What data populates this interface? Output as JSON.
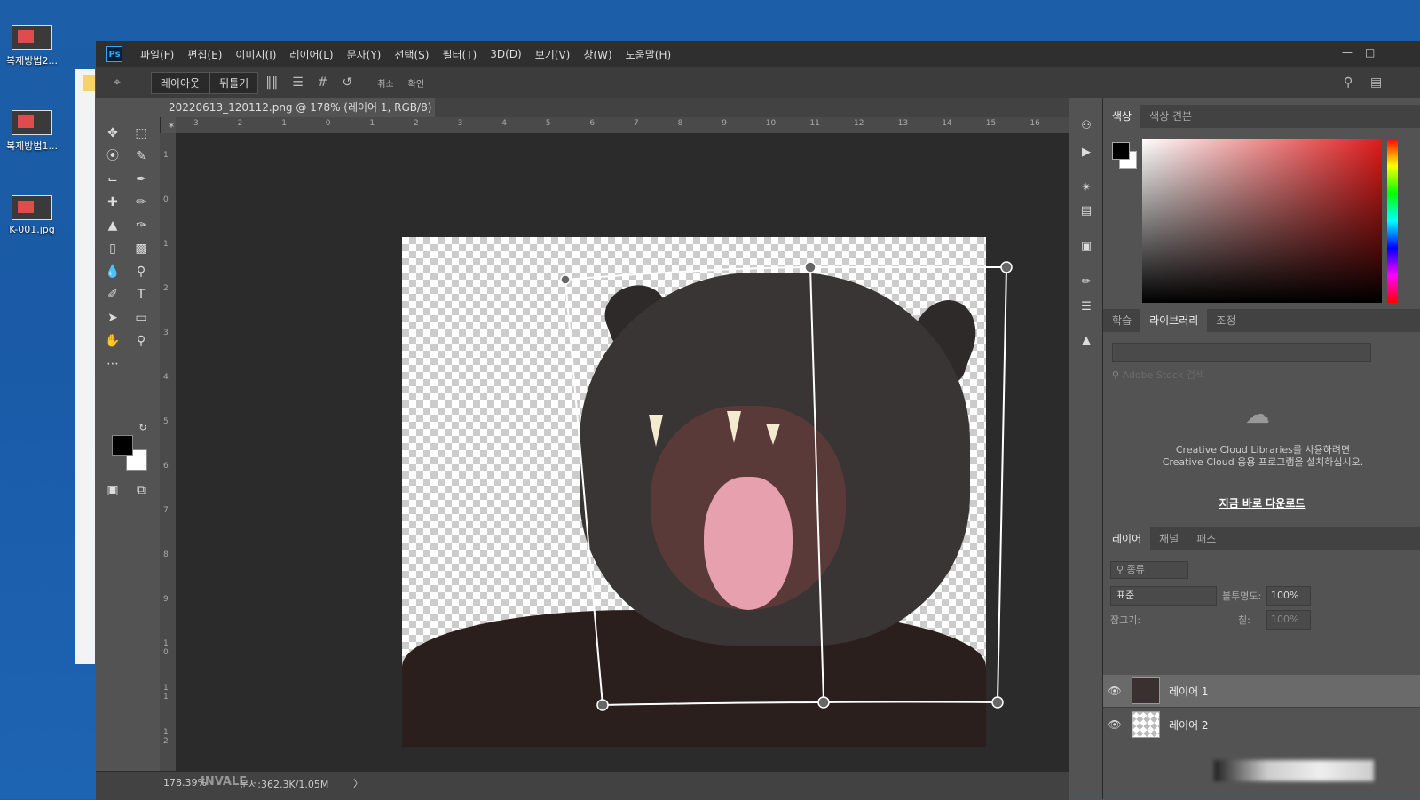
{
  "desktop": {
    "icons": [
      {
        "label": "복제방법2..."
      },
      {
        "label": "복제방법1..."
      },
      {
        "label": "K-001.jpg"
      }
    ]
  },
  "menubar": {
    "logo": "Ps",
    "items": [
      "파일(F)",
      "편집(E)",
      "이미지(I)",
      "레이어(L)",
      "문자(Y)",
      "선택(S)",
      "필터(T)",
      "3D(D)",
      "보기(V)",
      "창(W)",
      "도움말(H)"
    ]
  },
  "options": {
    "layout_btn": "레이아웃",
    "warp_btn": "뒤틀기",
    "cancel": "취소",
    "commit": "확인"
  },
  "document": {
    "tab_title": "20220613_120112.png @ 178% (레이어 1, RGB/8) *",
    "close": "×",
    "ruler_top": [
      "3",
      "2",
      "1",
      "0",
      "1",
      "2",
      "3",
      "4",
      "5",
      "6",
      "7",
      "8",
      "9",
      "10",
      "11",
      "12",
      "13",
      "14",
      "15",
      "16"
    ],
    "ruler_left": [
      "1",
      "0",
      "1",
      "2",
      "3",
      "4",
      "5",
      "6",
      "7",
      "8",
      "9",
      "1 0",
      "1 1",
      "1 2"
    ]
  },
  "status": {
    "zoom": "178.39%",
    "doc": "문서:362.3K/1.05M",
    "arrow": "〉"
  },
  "color_panel": {
    "tabs": [
      "색상",
      "색상 견본"
    ],
    "active_tab": "색상"
  },
  "library_panel": {
    "tabs": [
      "학습",
      "라이브러리",
      "조정"
    ],
    "active_tab": "라이브러리",
    "search_placeholder": "Adobe Stock 검색",
    "message": "Creative Cloud Libraries를 사용하려면 Creative Cloud 응용 프로그램을 설치하십시오.",
    "link": "지금 바로 다운로드"
  },
  "layers_panel": {
    "tabs": [
      "레이어",
      "채널",
      "패스"
    ],
    "active_tab": "레이어",
    "filter_label": "종류",
    "blend_mode": "표준",
    "opacity_label": "불투명도:",
    "opacity_value": "100%",
    "lock_label": "잠그기:",
    "fill_label": "칠:",
    "fill_value": "100%",
    "layers": [
      {
        "name": "레이어 1",
        "selected": true
      },
      {
        "name": "레이어 2",
        "selected": false
      }
    ]
  },
  "watermark": "INVALE"
}
